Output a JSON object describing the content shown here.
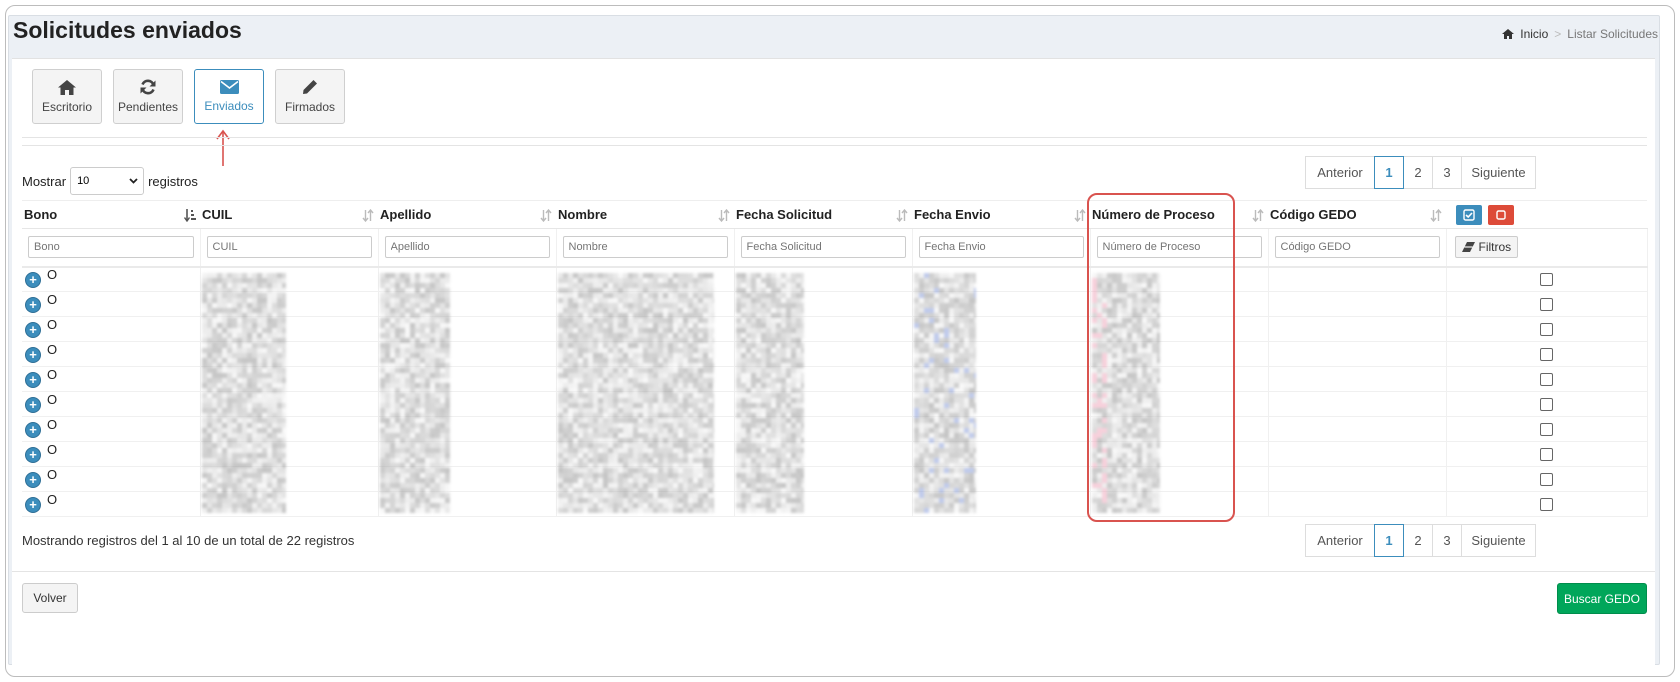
{
  "page": {
    "title": "Solicitudes enviados"
  },
  "breadcrumb": {
    "home": "Inicio",
    "separator": ">",
    "current": "Listar Solicitudes"
  },
  "tabs": [
    {
      "label": "Escritorio",
      "icon": "home-icon",
      "active": false
    },
    {
      "label": "Pendientes",
      "icon": "refresh-icon",
      "active": false
    },
    {
      "label": "Enviados",
      "icon": "envelope-icon",
      "active": true
    },
    {
      "label": "Firmados",
      "icon": "pencil-icon",
      "active": false
    }
  ],
  "length": {
    "prefix": "Mostrar",
    "value": "10",
    "suffix": "registros"
  },
  "pagination": {
    "prev": "Anterior",
    "pages": [
      "1",
      "2",
      "3"
    ],
    "current": "1",
    "next": "Siguiente"
  },
  "table": {
    "columns": [
      "Bono",
      "CUIL",
      "Apellido",
      "Nombre",
      "Fecha Solicitud",
      "Fecha Envio",
      "Número de Proceso",
      "Código GEDO"
    ],
    "filter_placeholders": [
      "Bono",
      "CUIL",
      "Apellido",
      "Nombre",
      "Fecha Solicitud",
      "Fecha Envio",
      "Número de Proceso",
      "Código GEDO"
    ],
    "filter_button": "Filtros",
    "rows": [
      {
        "bono": "O"
      },
      {
        "bono": "O"
      },
      {
        "bono": "O"
      },
      {
        "bono": "O"
      },
      {
        "bono": "O"
      },
      {
        "bono": "O"
      },
      {
        "bono": "O"
      },
      {
        "bono": "O"
      },
      {
        "bono": "O"
      },
      {
        "bono": "O"
      }
    ]
  },
  "info": "Mostrando registros del 1 al 10 de un total de 22 registros",
  "buttons": {
    "back": "Volver",
    "search_gedo": "Buscar GEDO"
  },
  "colors": {
    "primary": "#3c8dbc",
    "success": "#00a65a",
    "danger": "#dd4b39",
    "highlight": "#d9534f"
  }
}
